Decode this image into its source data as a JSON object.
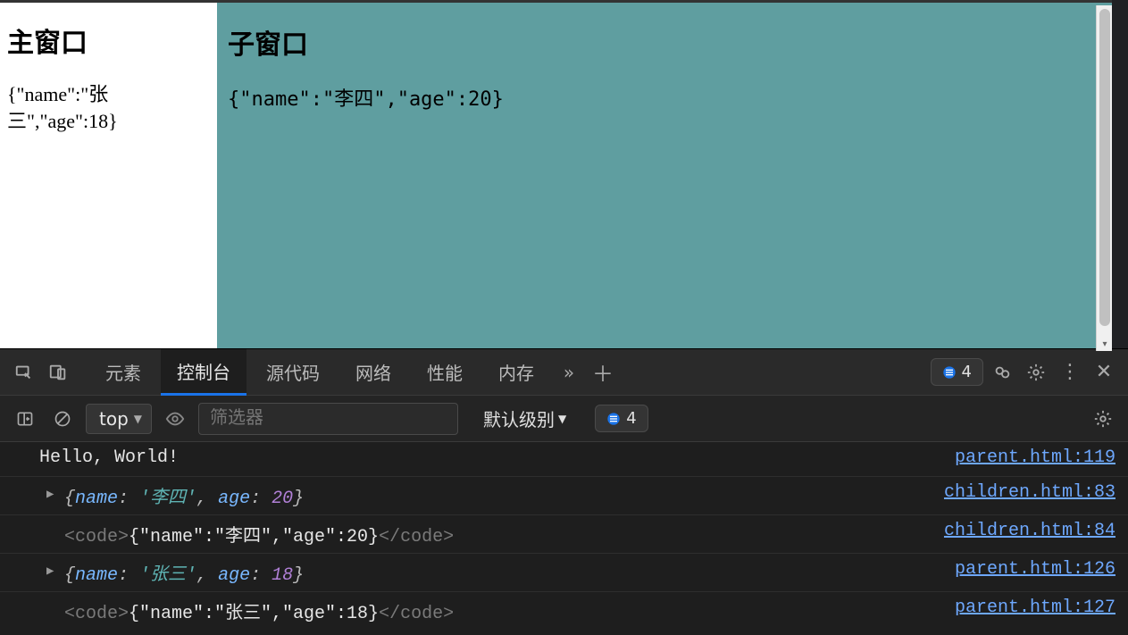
{
  "page": {
    "main_window": {
      "title": "主窗口",
      "json_text": "{\"name\":\"张三\",\"age\":18}"
    },
    "sub_window": {
      "title": "子窗口",
      "json_text": "{\"name\":\"李四\",\"age\":20}"
    },
    "sub_window_bg": "#5f9ea0"
  },
  "devtools": {
    "tabs": {
      "elements": "元素",
      "console": "控制台",
      "sources": "源代码",
      "network": "网络",
      "performance": "性能",
      "memory": "内存"
    },
    "active_tab": "console",
    "issue_count": "4",
    "toolbar": {
      "context": "top",
      "filter_placeholder": "筛选器",
      "level_label": "默认级别",
      "message_count": "4"
    },
    "console_rows": [
      {
        "kind": "plain",
        "text": "Hello, World!",
        "source": "parent.html:119"
      },
      {
        "kind": "object",
        "key1": "name",
        "val1": "'李四'",
        "key2": "age",
        "val2": "20",
        "source": "children.html:83"
      },
      {
        "kind": "html",
        "inner": "{\"name\":\"李四\",\"age\":20}",
        "source": "children.html:84"
      },
      {
        "kind": "object",
        "key1": "name",
        "val1": "'张三'",
        "key2": "age",
        "val2": "18",
        "source": "parent.html:126"
      },
      {
        "kind": "html",
        "inner": "{\"name\":\"张三\",\"age\":18}",
        "source": "parent.html:127"
      }
    ]
  }
}
